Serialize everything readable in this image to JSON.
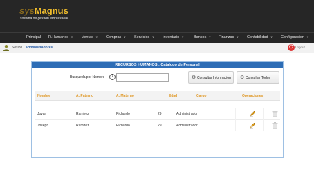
{
  "header": {
    "brand_prefix": "sysMagnus",
    "brand_name": "Magnus",
    "brand_thin": "sys",
    "tagline": "sistema de gestion empresarial"
  },
  "nav": {
    "items": [
      {
        "label": "Principal",
        "has_caret": false
      },
      {
        "label": "R.Humanos",
        "has_caret": true
      },
      {
        "label": "Ventas",
        "has_caret": true
      },
      {
        "label": "Compras",
        "has_caret": true
      },
      {
        "label": "Servicios",
        "has_caret": true
      },
      {
        "label": "Inventario",
        "has_caret": true
      },
      {
        "label": "Bancos",
        "has_caret": true
      },
      {
        "label": "Finanzas",
        "has_caret": true
      },
      {
        "label": "Contabilidad",
        "has_caret": true
      },
      {
        "label": "Configuracion",
        "has_caret": true
      }
    ],
    "caret": "▼"
  },
  "session": {
    "label": "Sesion :",
    "user": "Administradores",
    "logout": "Logout",
    "logout_icon": "power-icon"
  },
  "panel": {
    "title": "RECURSOS HUMANOS : Catalogo de Personal",
    "search_label": "Busqueda por Nombre",
    "search_value": "",
    "search_placeholder": "",
    "help_glyph": "?",
    "btn_info": "Consultar Informacion",
    "btn_all": "Consultar Todos"
  },
  "table": {
    "headers": [
      "Nombre",
      "A. Paterno",
      "A. Materno",
      "Edad",
      "Cargo",
      "Operaciones"
    ],
    "rows": [
      {
        "nombre": "Jovan",
        "paterno": "Ramirez",
        "materno": "Pichardo",
        "edad": "29",
        "cargo": "Administrador"
      },
      {
        "nombre": "Joseph",
        "paterno": "Ramirez",
        "materno": "Pichardo",
        "edad": "29",
        "cargo": "Administrador"
      }
    ]
  },
  "colors": {
    "header_bg": "#262626",
    "brand_gold": "#f0bd2c",
    "panel_title_bg": "#2d6db6",
    "table_header_text": "#e09a2a",
    "session_user": "#2a5ea8"
  }
}
